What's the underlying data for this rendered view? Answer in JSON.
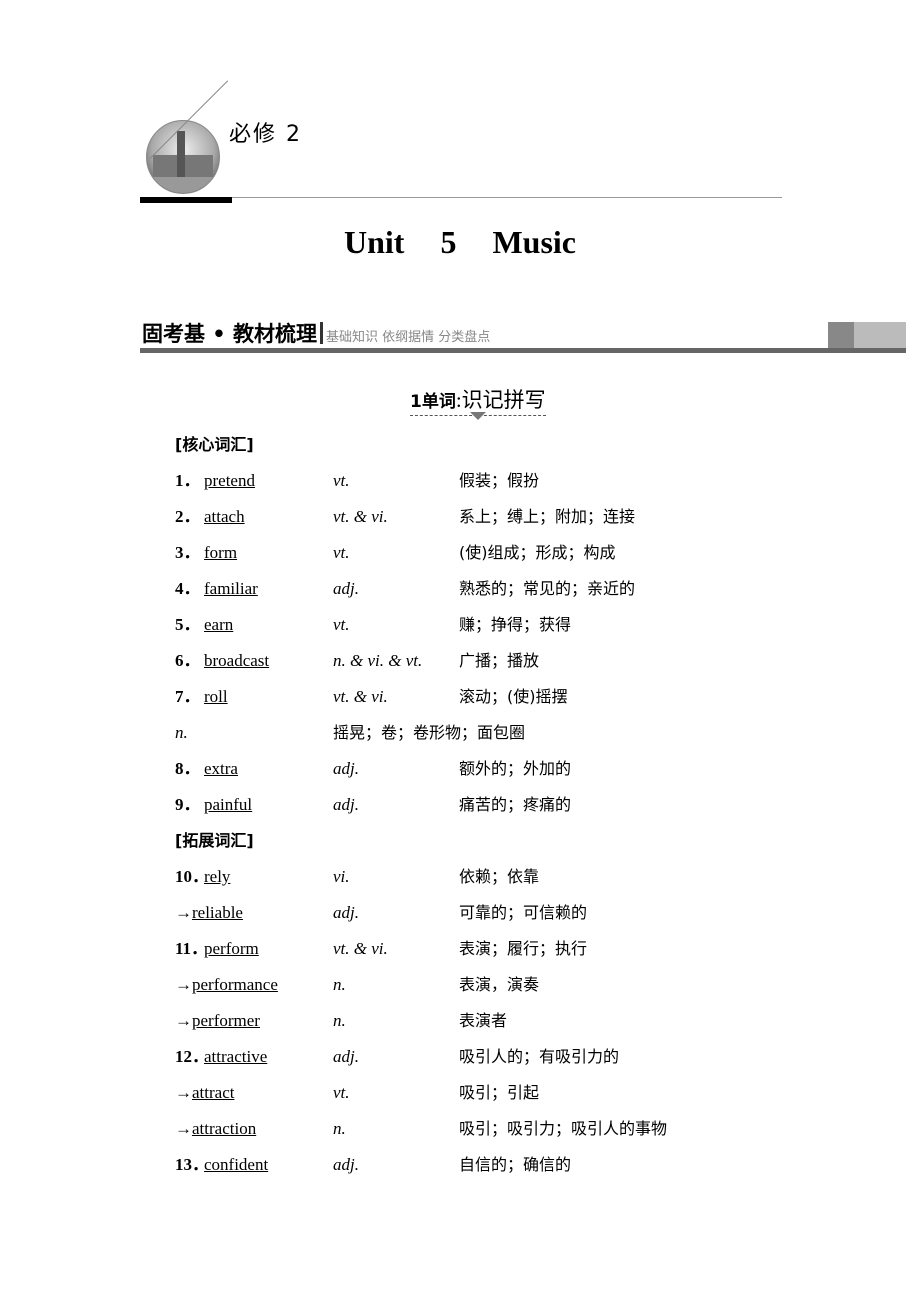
{
  "header": {
    "course": "必修 2",
    "title": "Unit 5 Music"
  },
  "section": {
    "title": "固考基 • 教材梳理",
    "subtitle": "基础知识  依纲据情  分类盘点"
  },
  "subsection": {
    "num": "1",
    "label": "单词",
    "rest": ":识记拼写"
  },
  "rows": [
    {
      "type": "cat",
      "text": "[核心词汇]"
    },
    {
      "num": "1．",
      "word": "pretend",
      "pos": "vt.",
      "mean": "假装；假扮"
    },
    {
      "num": "2．",
      "word": "attach",
      "pos": "vt. & vi.",
      "mean": "系上；缚上；附加；连接"
    },
    {
      "num": "3．",
      "word": "form",
      "pos": "vt.",
      "mean": "(使)组成；形成；构成"
    },
    {
      "num": "4．",
      "word": "familiar",
      "pos": "adj.",
      "mean": "熟悉的；常见的；亲近的"
    },
    {
      "num": "5．",
      "word": "earn",
      "pos": "vt.",
      "mean": "赚；挣得；获得"
    },
    {
      "num": "6．",
      "word": "broadcast",
      "pos": "n. & vi. & vt.",
      "mean": "广播；播放"
    },
    {
      "num": "7．",
      "word": "roll",
      "pos": "vt. & vi.",
      "mean": "滚动；(使)摇摆"
    },
    {
      "type": "alt",
      "pos": "n.",
      "mean": "摇晃；卷；卷形物；面包圈"
    },
    {
      "num": "8．",
      "word": "extra",
      "pos": "adj.",
      "mean": "额外的；外加的"
    },
    {
      "num": "9．",
      "word": "painful",
      "pos": "adj.",
      "mean": "痛苦的；疼痛的"
    },
    {
      "type": "cat",
      "text": "[拓展词汇]"
    },
    {
      "num": "10．",
      "word": "rely",
      "pos": "vi.",
      "mean": "依赖；依靠"
    },
    {
      "type": "arrow",
      "arrow": "→",
      "word": "reliable",
      "pos": "adj.",
      "mean": "可靠的；可信赖的"
    },
    {
      "num": "11．",
      "word": "perform",
      "pos": "vt. & vi.",
      "mean": "表演；履行；执行"
    },
    {
      "type": "arrow",
      "arrow": "→",
      "word": "performance",
      "pos": "n.",
      "mean": "表演，演奏"
    },
    {
      "type": "arrow",
      "arrow": "→",
      "word": "performer",
      "pos": "n.",
      "mean": "表演者"
    },
    {
      "num": "12．",
      "word": "attractive",
      "pos": "adj.",
      "mean": "吸引人的；有吸引力的"
    },
    {
      "type": "arrow",
      "arrow": "→",
      "word": "attract",
      "pos": "vt.",
      "mean": "吸引；引起"
    },
    {
      "type": "arrow",
      "arrow": "→",
      "word": "attraction",
      "pos": "n.",
      "mean": "吸引；吸引力；吸引人的事物"
    },
    {
      "num": "13．",
      "word": "confident",
      "pos": "adj.",
      "mean": "自信的；确信的"
    }
  ]
}
